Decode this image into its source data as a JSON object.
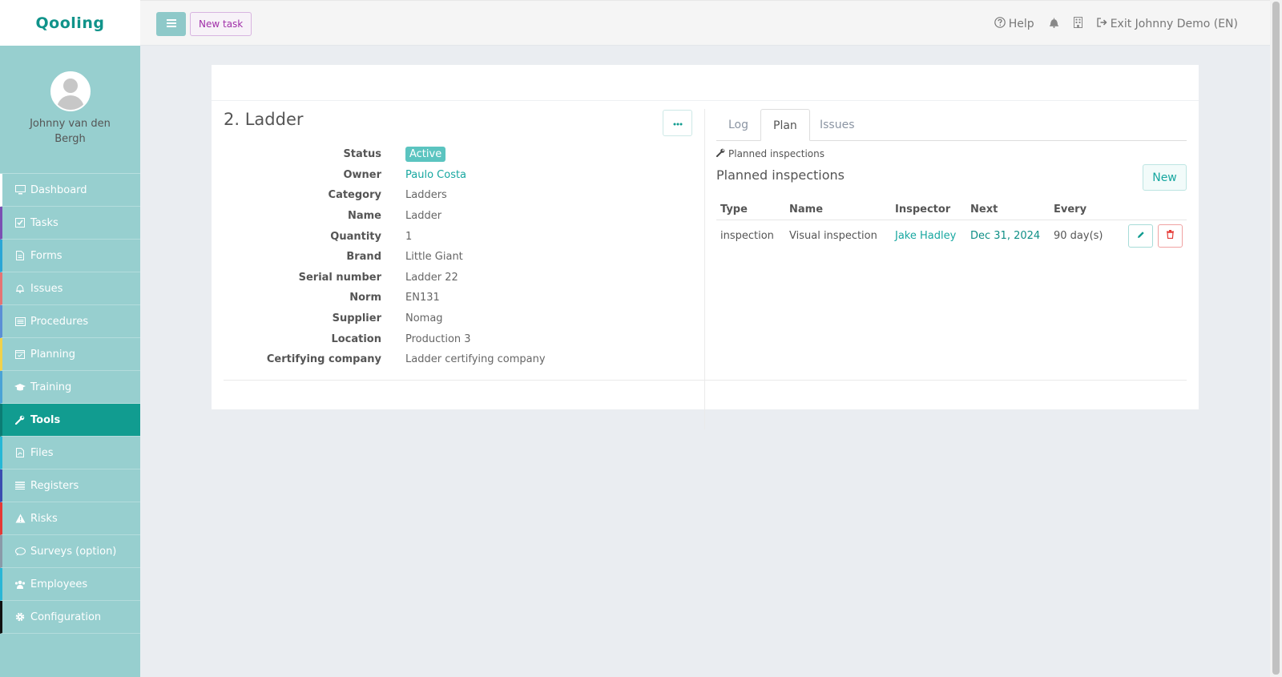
{
  "app": {
    "logo": "Qooling"
  },
  "profile": {
    "name": "Johnny van den Bergh"
  },
  "sidebar": {
    "items": [
      {
        "label": "Dashboard",
        "icon": "monitor-icon",
        "color": "#ffffff"
      },
      {
        "label": "Tasks",
        "icon": "check-square-icon",
        "color": "#7b4fb3"
      },
      {
        "label": "Forms",
        "icon": "file-icon",
        "color": "#2aa6d6"
      },
      {
        "label": "Issues",
        "icon": "bell-icon",
        "color": "#e57373"
      },
      {
        "label": "Procedures",
        "icon": "list-alt-icon",
        "color": "#5b8fd6"
      },
      {
        "label": "Planning",
        "icon": "calendar-icon",
        "color": "#f1d24b"
      },
      {
        "label": "Training",
        "icon": "graduation-cap-icon",
        "color": "#4aa3d6"
      },
      {
        "label": "Tools",
        "icon": "wrench-icon",
        "color": "#0b7c74"
      },
      {
        "label": "Files",
        "icon": "file-pdf-icon",
        "color": "#26b7d6"
      },
      {
        "label": "Registers",
        "icon": "list-icon",
        "color": "#3a4db0"
      },
      {
        "label": "Risks",
        "icon": "warning-icon",
        "color": "#e53935"
      },
      {
        "label": "Surveys (option)",
        "icon": "comment-icon",
        "color": "#8a9aa8"
      },
      {
        "label": "Employees",
        "icon": "users-icon",
        "color": "#29b6d6"
      },
      {
        "label": "Configuration",
        "icon": "gear-icon",
        "color": "#111111"
      }
    ]
  },
  "topbar": {
    "new_task": "New task",
    "help": "Help",
    "exit": "Exit Johnny Demo (EN)"
  },
  "tool": {
    "title": "2. Ladder",
    "fields": [
      {
        "label": "Status",
        "value": "Active",
        "type": "badge"
      },
      {
        "label": "Owner",
        "value": "Paulo Costa",
        "type": "link"
      },
      {
        "label": "Category",
        "value": "Ladders",
        "type": "text"
      },
      {
        "label": "Name",
        "value": "Ladder",
        "type": "text"
      },
      {
        "label": "Quantity",
        "value": "1",
        "type": "text"
      },
      {
        "label": "Brand",
        "value": "Little Giant",
        "type": "text"
      },
      {
        "label": "Serial number",
        "value": "Ladder 22",
        "type": "text"
      },
      {
        "label": "Norm",
        "value": "EN131",
        "type": "text"
      },
      {
        "label": "Supplier",
        "value": "Nomag",
        "type": "text"
      },
      {
        "label": "Location",
        "value": "Production 3",
        "type": "text"
      },
      {
        "label": "Certifying company",
        "value": "Ladder certifying company",
        "type": "text"
      }
    ]
  },
  "tabs": [
    "Log",
    "Plan",
    "Issues"
  ],
  "plan": {
    "crumb": "Planned inspections",
    "title": "Planned inspections",
    "new_label": "New",
    "columns": [
      "Type",
      "Name",
      "Inspector",
      "Next",
      "Every"
    ],
    "rows": [
      {
        "type": "inspection",
        "name": "Visual inspection",
        "inspector": "Jake Hadley",
        "next": "Dec 31, 2024",
        "every": "90 day(s)"
      }
    ]
  }
}
